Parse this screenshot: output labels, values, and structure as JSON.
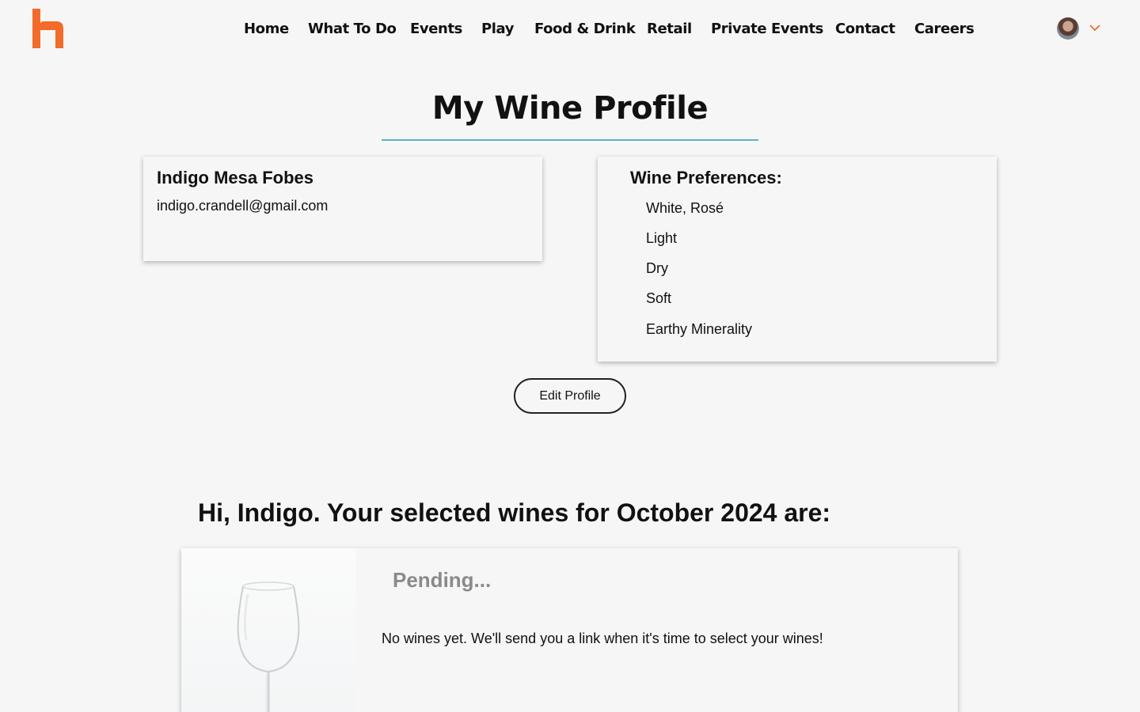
{
  "brand": {
    "accent_color": "#f26b2a",
    "rule_color": "#5fb3c3"
  },
  "nav": {
    "items": [
      {
        "label": "Home"
      },
      {
        "label": "What To Do"
      },
      {
        "label": "Events"
      },
      {
        "label": "Play"
      },
      {
        "label": "Food & Drink"
      },
      {
        "label": "Retail"
      },
      {
        "label": "Private Events"
      },
      {
        "label": "Contact"
      },
      {
        "label": "Careers"
      }
    ]
  },
  "user_menu": {
    "avatar_icon": "user-avatar",
    "dropdown_icon": "chevron-down-icon"
  },
  "page": {
    "title": "My Wine Profile"
  },
  "profile": {
    "name": "Indigo Mesa Fobes",
    "email": "indigo.crandell@gmail.com"
  },
  "preferences": {
    "title": "Wine Preferences:",
    "items": [
      "White, Rosé",
      "Light",
      "Dry",
      "Soft",
      "Earthy Minerality"
    ]
  },
  "edit_button": {
    "label": "Edit Profile"
  },
  "selection": {
    "greeting": "Hi, Indigo. Your selected wines for October 2024 are:",
    "status": "Pending...",
    "message": "No wines yet. We'll send you a link when it's time to select your wines!",
    "image_icon": "wine-glass-image"
  }
}
